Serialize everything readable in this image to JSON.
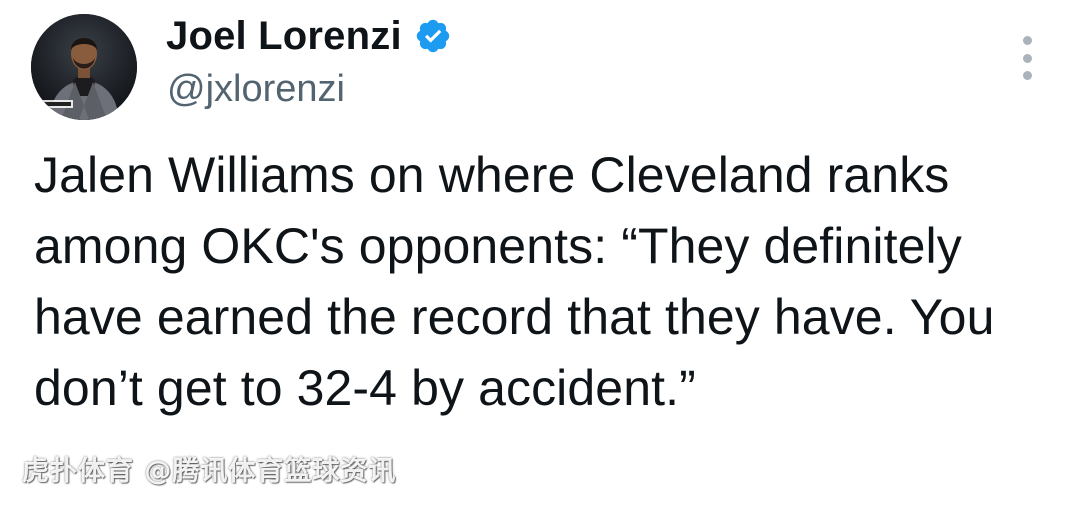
{
  "author": {
    "display_name": "Joel Lorenzi",
    "handle": "@jxlorenzi",
    "verified": true,
    "avatar_icon": "profile-photo",
    "verified_color": "#1d9bf0"
  },
  "tweet": {
    "text": "Jalen Williams on where Cleveland ranks among OKC's opponents: “They definitely have earned the record that they have. You don’t get to 32-4 by accident.”"
  },
  "menu": {
    "icon": "more-vertical-icon"
  },
  "watermark": {
    "text": "虎扑体育 @腾讯体育篮球资讯"
  },
  "colors": {
    "text_primary": "#0f1419",
    "text_secondary": "#536471",
    "background": "#ffffff"
  }
}
